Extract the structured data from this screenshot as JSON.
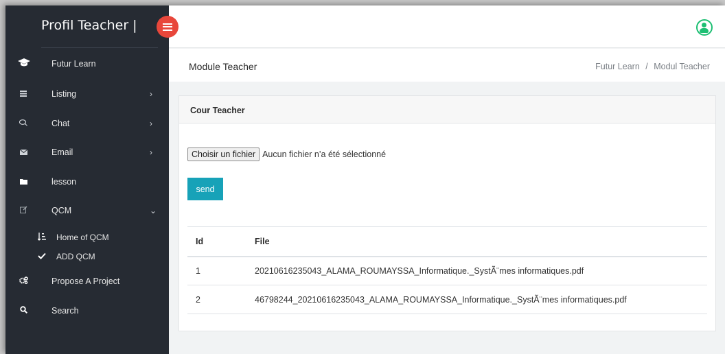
{
  "sidebar": {
    "brand": "Profil Teacher |",
    "items": [
      {
        "label": "Futur Learn",
        "icon": "graduation-cap-icon"
      },
      {
        "label": "Listing",
        "icon": "list-icon"
      },
      {
        "label": "Chat",
        "icon": "chat-icon"
      },
      {
        "label": "Email",
        "icon": "envelope-icon"
      },
      {
        "label": "lesson",
        "icon": "folder-icon"
      },
      {
        "label": "QCM",
        "icon": "edit-icon"
      },
      {
        "label": "Propose A Project",
        "icon": "gears-icon"
      },
      {
        "label": "Search",
        "icon": "search-icon"
      }
    ],
    "qcm_sub": [
      {
        "label": "Home of QCM",
        "icon": "sort-icon"
      },
      {
        "label": "ADD QCM",
        "icon": "check-icon"
      }
    ]
  },
  "header": {
    "page_title": "Module Teacher",
    "breadcrumb_home": "Futur Learn",
    "breadcrumb_sep": "/",
    "breadcrumb_current": "Modul Teacher"
  },
  "card": {
    "title": "Cour Teacher",
    "file_button": "Choisir un fichier",
    "file_status": "Aucun fichier n’a été sélectionné",
    "send_label": "send",
    "columns": [
      "Id",
      "File"
    ],
    "rows": [
      {
        "id": "1",
        "file": "20210616235043_ALAMA_ROUMAYSSA_Informatique._SystÃ¨mes informatiques.pdf"
      },
      {
        "id": "2",
        "file": "46798244_20210616235043_ALAMA_ROUMAYSSA_Informatique._SystÃ¨mes informatiques.pdf"
      }
    ]
  },
  "colors": {
    "sidebar": "#262b33",
    "toggle": "#e8473b",
    "accent": "#17a2b8",
    "user": "#1dbf73"
  }
}
